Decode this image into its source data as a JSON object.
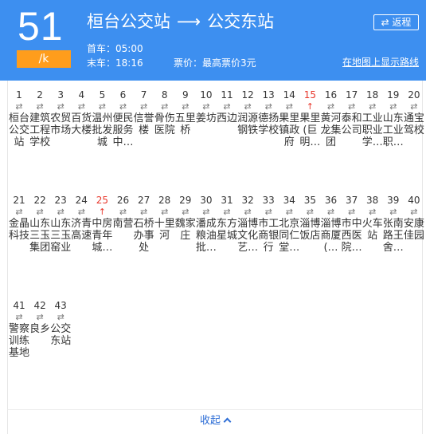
{
  "header": {
    "route_number": "51",
    "fare_tag": "/k",
    "from": "桓台公交站",
    "arrow": "⟶",
    "to": "公交东站",
    "first_bus": "首车：05:00",
    "last_bus": "末车：18:16",
    "fare": "票价：最高票价3元",
    "return_label": "⇄ 返程",
    "map_link": "在地图上显示路线"
  },
  "colors": {
    "header_bg": "#3d8ff0",
    "badge": "#ff9d1c",
    "current_stop": "#e8382c",
    "link": "#2e6ed6"
  },
  "direction_icon": "⇄",
  "current_mark_icon": "↑",
  "stops": [
    {
      "num": "1",
      "name": "桓台公交站",
      "current": false
    },
    {
      "num": "2",
      "name": "建筑工程学校",
      "current": false
    },
    {
      "num": "3",
      "name": "农贸市场",
      "current": false
    },
    {
      "num": "4",
      "name": "百货大楼",
      "current": false
    },
    {
      "num": "5",
      "name": "温州批发城",
      "current": false
    },
    {
      "num": "6",
      "name": "便民服务中…",
      "current": false
    },
    {
      "num": "7",
      "name": "信誉楼",
      "current": false
    },
    {
      "num": "8",
      "name": "骨伤医院",
      "current": false
    },
    {
      "num": "9",
      "name": "五里桥",
      "current": false
    },
    {
      "num": "10",
      "name": "姜坊",
      "current": false
    },
    {
      "num": "11",
      "name": "西边",
      "current": false
    },
    {
      "num": "12",
      "name": "润源钢铁",
      "current": false
    },
    {
      "num": "13",
      "name": "德扬学校",
      "current": false
    },
    {
      "num": "14",
      "name": "果里镇政府",
      "current": false
    },
    {
      "num": "15",
      "name": "果里(巨明…",
      "current": true
    },
    {
      "num": "16",
      "name": "黄河龙集团",
      "current": false
    },
    {
      "num": "17",
      "name": "泰和公司",
      "current": false
    },
    {
      "num": "18",
      "name": "工业职业学…",
      "current": false
    },
    {
      "num": "19",
      "name": "山东工业职…",
      "current": false
    },
    {
      "num": "20",
      "name": "通宝驾校",
      "current": false
    },
    {
      "num": "21",
      "name": "金晶科技",
      "current": false
    },
    {
      "num": "22",
      "name": "山东三玉集团",
      "current": false
    },
    {
      "num": "23",
      "name": "山东三玉窑业",
      "current": false
    },
    {
      "num": "24",
      "name": "济青高速",
      "current": false
    },
    {
      "num": "25",
      "name": "中房青年城…",
      "current": true
    },
    {
      "num": "26",
      "name": "南营",
      "current": false
    },
    {
      "num": "27",
      "name": "石桥办事处",
      "current": false
    },
    {
      "num": "28",
      "name": "十里河",
      "current": false
    },
    {
      "num": "29",
      "name": "魏家庄",
      "current": false
    },
    {
      "num": "30",
      "name": "潘成粮油批…",
      "current": false
    },
    {
      "num": "31",
      "name": "东方星城",
      "current": false
    },
    {
      "num": "32",
      "name": "淄博文化艺…",
      "current": false
    },
    {
      "num": "33",
      "name": "市工商银行",
      "current": false
    },
    {
      "num": "34",
      "name": "北京同仁堂…",
      "current": false
    },
    {
      "num": "35",
      "name": "淄博饭店",
      "current": false
    },
    {
      "num": "36",
      "name": "淄博商厦(…",
      "current": false
    },
    {
      "num": "37",
      "name": "市中西医院…",
      "current": false
    },
    {
      "num": "38",
      "name": "火车站",
      "current": false
    },
    {
      "num": "39",
      "name": "张南路王舍…",
      "current": false
    },
    {
      "num": "40",
      "name": "安康佳园",
      "current": false
    },
    {
      "num": "41",
      "name": "警察训练基地",
      "current": false
    },
    {
      "num": "42",
      "name": "良乡",
      "current": false
    },
    {
      "num": "43",
      "name": "公交东站",
      "current": false
    }
  ],
  "footer": {
    "collapse_label": "收起"
  }
}
